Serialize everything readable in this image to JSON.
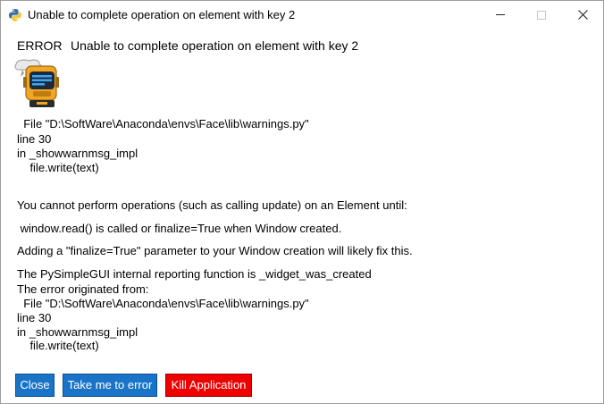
{
  "window": {
    "title": "Unable to complete operation on element with key 2",
    "icon": "python-icon",
    "controls": {
      "minimize": "minimize-icon",
      "maximize": "maximize-icon",
      "close": "close-icon"
    }
  },
  "error": {
    "label": "ERROR",
    "message": "Unable to complete operation on element with key 2",
    "image": "robot-icon"
  },
  "trace1": {
    "file": "  File \"D:\\SoftWare\\Anaconda\\envs\\Face\\lib\\warnings.py\"",
    "line": "line 30",
    "func": "in _showwarnmsg_impl",
    "code": "    file.write(text)"
  },
  "explanation": {
    "p1": "You cannot perform operations (such as calling update) on an Element until:",
    "p2": " window.read() is called or finalize=True when Window created.",
    "p3": "Adding a \"finalize=True\" parameter to your Window creation will likely fix this.",
    "p4": "The PySimpleGUI internal reporting function is _widget_was_created",
    "p5": "The error originated from:"
  },
  "trace2": {
    "file": "  File \"D:\\SoftWare\\Anaconda\\envs\\Face\\lib\\warnings.py\"",
    "line": "line 30",
    "func": "in _showwarnmsg_impl",
    "code": "    file.write(text)"
  },
  "buttons": {
    "close": "Close",
    "take_me": "Take me to error",
    "kill": "Kill Application"
  },
  "colors": {
    "button_blue": "#1974c8",
    "button_red": "#ee0000"
  }
}
